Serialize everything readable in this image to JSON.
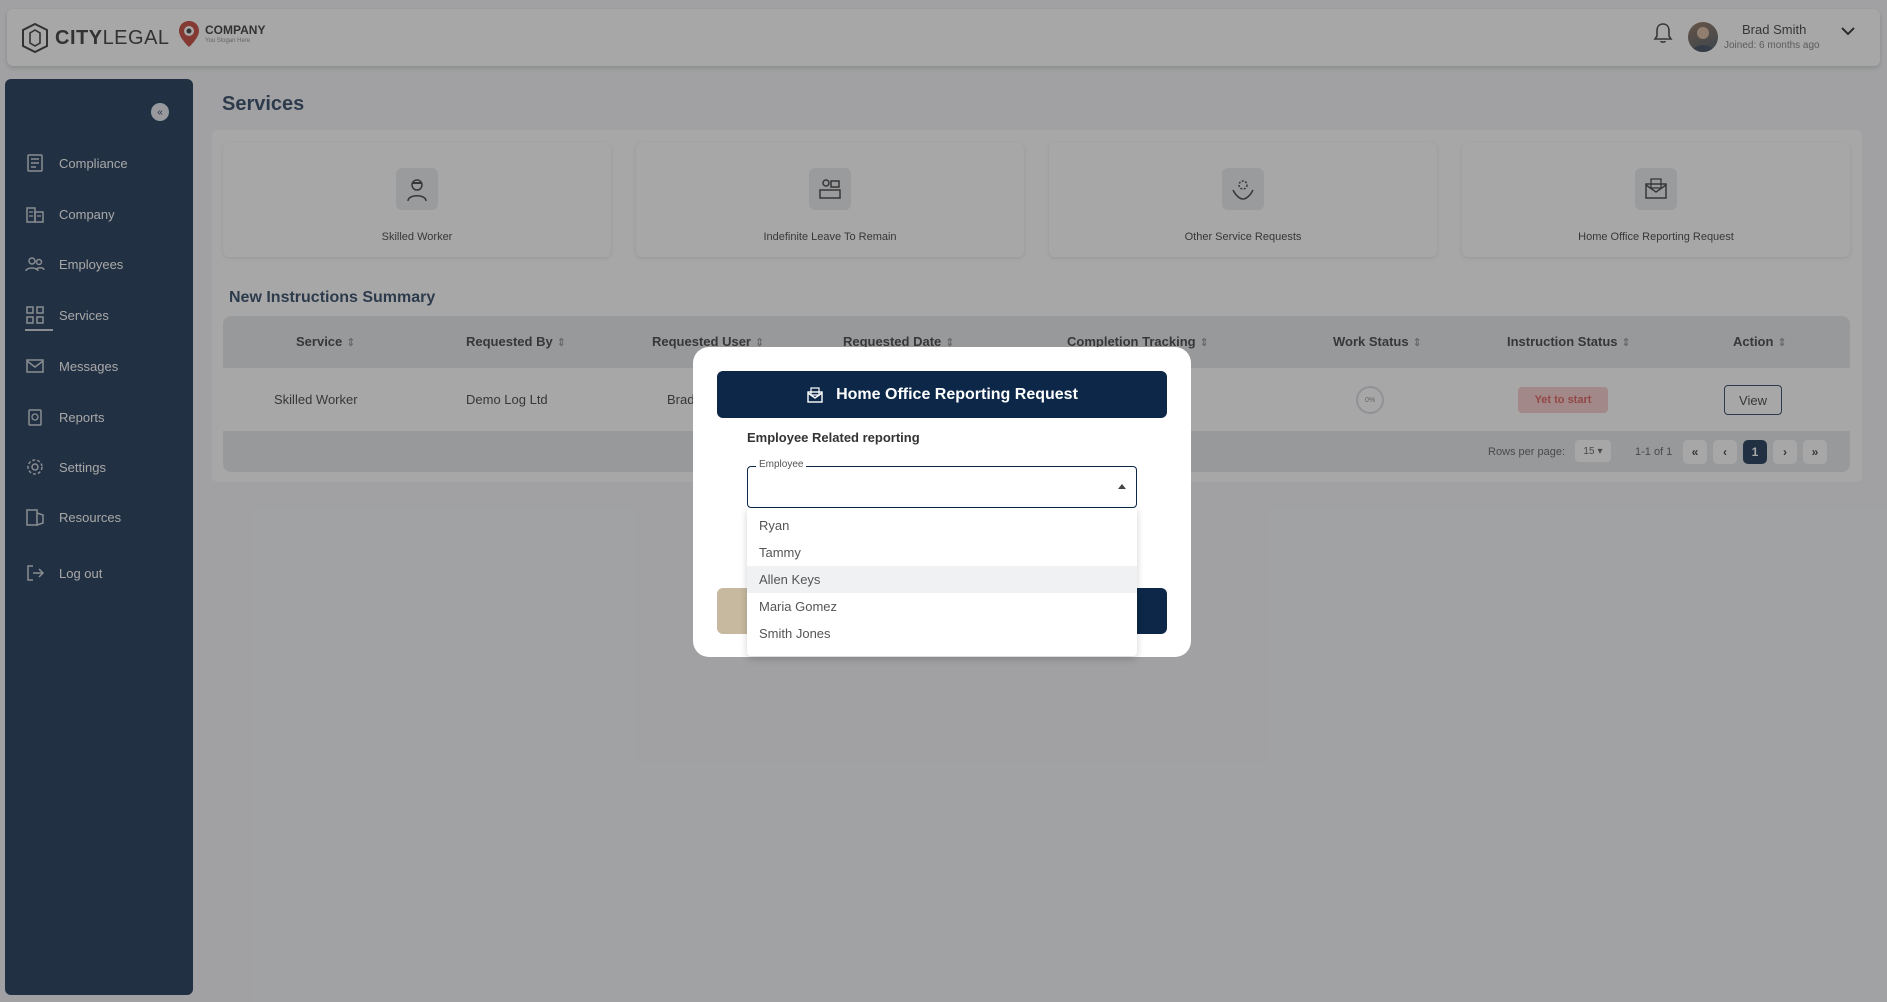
{
  "app": {
    "logo_bold": "CITY",
    "logo_light": "LEGAL",
    "company_name": "COMPANY",
    "company_slogan": "You Slogan Here"
  },
  "user": {
    "name": "Brad Smith",
    "joined": "Joined: 6 months ago"
  },
  "sidebar": {
    "items": [
      {
        "label": "Compliance",
        "icon": "compliance-icon"
      },
      {
        "label": "Company",
        "icon": "company-icon"
      },
      {
        "label": "Employees",
        "icon": "employees-icon"
      },
      {
        "label": "Services",
        "icon": "services-icon"
      },
      {
        "label": "Messages",
        "icon": "messages-icon"
      },
      {
        "label": "Reports",
        "icon": "reports-icon"
      },
      {
        "label": "Settings",
        "icon": "settings-icon"
      },
      {
        "label": "Resources",
        "icon": "resources-icon"
      },
      {
        "label": "Log out",
        "icon": "logout-icon"
      }
    ],
    "active": "Services"
  },
  "page": {
    "title": "Services"
  },
  "services": [
    {
      "label": "Skilled Worker",
      "icon": "worker-icon"
    },
    {
      "label": "Indefinite Leave To Remain",
      "icon": "desk-icon"
    },
    {
      "label": "Other Service Requests",
      "icon": "hands-gear-icon"
    },
    {
      "label": "Home Office Reporting Request",
      "icon": "report-envelope-icon"
    }
  ],
  "instructions": {
    "title": "New Instructions Summary",
    "columns": [
      "Service",
      "Requested By",
      "Requested User",
      "Requested Date",
      "Completion Tracking",
      "Work Status",
      "Instruction Status",
      "Action"
    ],
    "rows": [
      {
        "service": "Skilled Worker",
        "requested_by": "Demo Log Ltd",
        "requested_user": "Brad",
        "work_status": "0%",
        "instruction_status": "Yet to start",
        "action": "View"
      }
    ],
    "footer": {
      "rows_per_page_label": "Rows per page:",
      "rows_per_page_value": "15",
      "range": "1-1 of 1",
      "current_page": "1"
    }
  },
  "modal": {
    "title": "Home Office Reporting Request",
    "subtitle": "Employee Related reporting",
    "employee_label": "Employee",
    "employee_options": [
      "Ryan",
      "Tammy",
      "Allen Keys",
      "Maria Gomez",
      "Smith Jones"
    ],
    "hovered_option": "Allen Keys"
  },
  "colors": {
    "navy": "#0c2748",
    "badge_bg": "#f6c6c6",
    "badge_text": "#d9534f",
    "tan": "#c7b9a0"
  }
}
